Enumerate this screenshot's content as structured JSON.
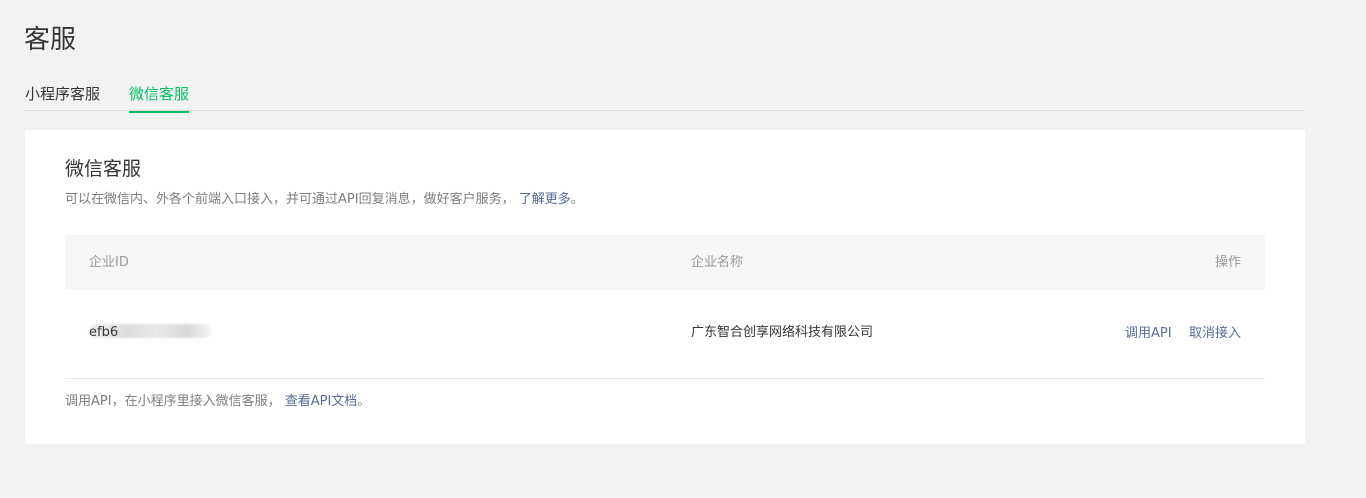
{
  "page": {
    "title": "客服"
  },
  "tabs": [
    {
      "label": "小程序客服",
      "active": false
    },
    {
      "label": "微信客服",
      "active": true
    }
  ],
  "card": {
    "title": "微信客服",
    "description": "可以在微信内、外各个前端入口接入，并可通过API回复消息，做好客户服务，",
    "learn_more": "了解更多",
    "learn_more_suffix": "。"
  },
  "table": {
    "headers": {
      "id": "企业ID",
      "name": "企业名称",
      "actions": "操作"
    },
    "rows": [
      {
        "id_visible": "efb6",
        "name": "广东智合创享网络科技有限公司",
        "action_api": "调用API",
        "action_cancel": "取消接入"
      }
    ]
  },
  "footer": {
    "text": "调用API，在小程序里接入微信客服，",
    "link": "查看API文档",
    "suffix": "。"
  },
  "colors": {
    "accent": "#07c160",
    "link": "#576b95",
    "background": "#f2f2f2"
  }
}
